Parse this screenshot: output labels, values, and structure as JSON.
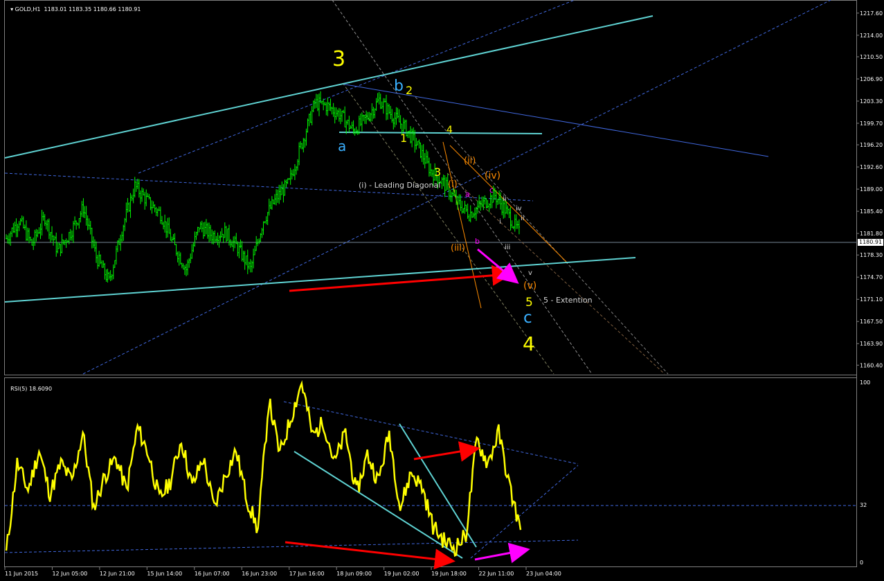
{
  "header": {
    "symbol": "GOLD,H1",
    "ohlc": "1183.01 1183.35 1180.66 1180.91",
    "rsi_label": "RSI(5)",
    "rsi_value": "18.6090"
  },
  "current_price": "1180.91",
  "colors": {
    "background": "#000000",
    "candles": "#00ff00",
    "rsi_line": "#ffff00",
    "trendline_cyan": "#5fd3d3",
    "channel_blue": "#4169e1",
    "arrow_red": "#ff0000",
    "arrow_magenta": "#ff00ff",
    "wave_yellow": "#ffff00",
    "wave_blue": "#3ab0ff",
    "wave_orange": "#ff8c00"
  },
  "chart_data": [
    {
      "type": "candlestick",
      "price_axis_ticks": [
        "1217.60",
        "1214.00",
        "1210.50",
        "1206.90",
        "1203.30",
        "1199.70",
        "1196.20",
        "1192.60",
        "1189.00",
        "1185.40",
        "1181.80",
        "1178.30",
        "1174.70",
        "1171.10",
        "1167.50",
        "1163.90",
        "1160.40"
      ],
      "ylim": [
        1159.2,
        1218.6
      ],
      "close_series_approx": [
        1181.0,
        1184.0,
        1180.0,
        1184.5,
        1179.0,
        1182.0,
        1186.0,
        1178.0,
        1174.0,
        1182.5,
        1189.5,
        1187.0,
        1185.0,
        1180.0,
        1176.0,
        1183.0,
        1181.5,
        1182.0,
        1179.5,
        1176.0,
        1184.0,
        1187.5,
        1190.0,
        1196.5,
        1203.0,
        1202.5,
        1201.0,
        1198.5,
        1200.5,
        1203.5,
        1201.0,
        1199.0,
        1196.0,
        1192.0,
        1190.0,
        1187.0,
        1185.0,
        1186.5,
        1188.0,
        1185.0,
        1181.5
      ],
      "wave_labels": [
        {
          "text": "3",
          "color": "yellow"
        },
        {
          "text": "b",
          "color": "blue"
        },
        {
          "text": "2",
          "color": "yellow"
        },
        {
          "text": "a",
          "color": "blue"
        },
        {
          "text": "1",
          "color": "yellow"
        },
        {
          "text": "4",
          "color": "yellow"
        },
        {
          "text": "3",
          "color": "yellow"
        },
        {
          "text": "(ii)",
          "color": "orange"
        },
        {
          "text": "(iv)",
          "color": "orange"
        },
        {
          "text": "(i)",
          "color": "orange"
        },
        {
          "text": "(i) - Leading Diagonal",
          "color": "white"
        },
        {
          "text": "a",
          "color": "magenta"
        },
        {
          "text": "c",
          "color": "magenta"
        },
        {
          "text": "ii",
          "color": "white"
        },
        {
          "text": "iv",
          "color": "white"
        },
        {
          "text": "i",
          "color": "white"
        },
        {
          "text": "ii",
          "color": "white"
        },
        {
          "text": "(iii)",
          "color": "orange"
        },
        {
          "text": "b",
          "color": "magenta"
        },
        {
          "text": "iii",
          "color": "white"
        },
        {
          "text": "v",
          "color": "white"
        },
        {
          "text": "(v)",
          "color": "orange"
        },
        {
          "text": "5",
          "color": "yellow"
        },
        {
          "text": "5 - Extention",
          "color": "white"
        },
        {
          "text": "c",
          "color": "blue"
        },
        {
          "text": "4",
          "color": "yellow"
        }
      ]
    },
    {
      "type": "line",
      "name": "RSI(5)",
      "ylim": [
        0,
        100
      ],
      "axis_ticks": [
        "100",
        "32",
        "0"
      ],
      "x_tick_labels": [
        "11 Jun 2015",
        "12 Jun 05:00",
        "12 Jun 21:00",
        "15 Jun 14:00",
        "16 Jun 07:00",
        "16 Jun 23:00",
        "17 Jun 16:00",
        "18 Jun 09:00",
        "19 Jun 02:00",
        "19 Jun 18:00",
        "22 Jun 11:00",
        "23 Jun 04:00"
      ],
      "values_approx": [
        5,
        55,
        40,
        62,
        38,
        55,
        45,
        72,
        30,
        48,
        58,
        40,
        75,
        60,
        35,
        45,
        68,
        42,
        58,
        30,
        48,
        62,
        35,
        18,
        90,
        60,
        80,
        100,
        70,
        78,
        55,
        72,
        38,
        60,
        45,
        72,
        30,
        50,
        42,
        20,
        12,
        8,
        15,
        68,
        55,
        72,
        42,
        18
      ]
    }
  ]
}
